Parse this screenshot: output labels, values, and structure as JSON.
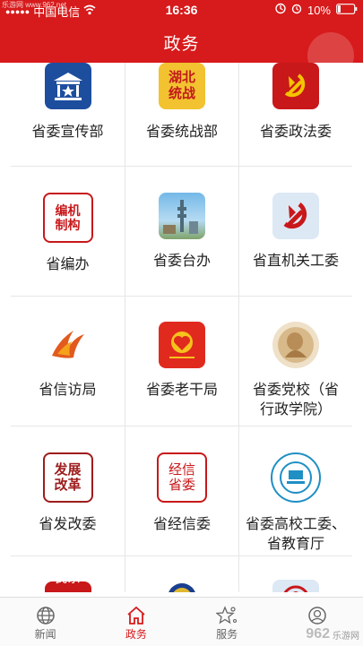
{
  "status": {
    "carrier": "中国电信",
    "time": "16:36",
    "battery": "10%"
  },
  "watermark_top": "乐游网 www.962.net",
  "header": {
    "title": "政务"
  },
  "grid": [
    [
      "省委宣传部",
      "省委统战部",
      "省委政法委"
    ],
    [
      "省编办",
      "省委台办",
      "省直机关工委"
    ],
    [
      "省信访局",
      "省委老干局",
      "省委党校（省行政学院）"
    ],
    [
      "省发改委",
      "省经信委",
      "省委高校工委、省教育厅"
    ]
  ],
  "icons": {
    "r1c2": "湖北统战",
    "r2c1": "编机制构",
    "r4c1": "发展改革",
    "r4c2": "经信省委",
    "partial_r5c1": "民宗"
  },
  "tabs": [
    {
      "label": "新闻",
      "icon": "globe-icon"
    },
    {
      "label": "政务",
      "icon": "home-icon"
    },
    {
      "label": "服务",
      "icon": "star-icon"
    },
    {
      "label": "",
      "icon": "user-icon"
    }
  ],
  "watermark_br": {
    "big": "962",
    "small": "乐游网"
  },
  "colors": {
    "brand": "#d71a1b"
  }
}
